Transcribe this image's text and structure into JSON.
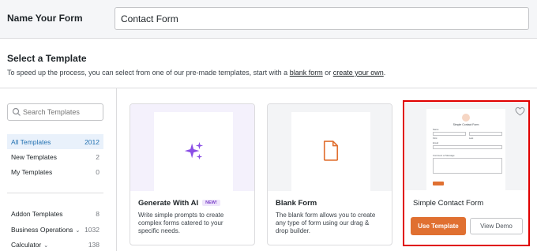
{
  "header": {
    "name_label": "Name Your Form",
    "name_value": "Contact Form"
  },
  "intro": {
    "title": "Select a Template",
    "desc_prefix": "To speed up the process, you can select from one of our pre-made templates, start with a ",
    "blank_link": "blank form",
    "desc_middle": " or ",
    "own_link": "create your own",
    "desc_suffix": "."
  },
  "sidebar": {
    "search_placeholder": "Search Templates",
    "items": [
      {
        "label": "All Templates",
        "count": "2012"
      },
      {
        "label": "New Templates",
        "count": "2"
      },
      {
        "label": "My Templates",
        "count": "0"
      },
      {
        "label": "Addon Templates",
        "count": "8"
      },
      {
        "label": "Business Operations",
        "count": "1032"
      },
      {
        "label": "Calculator",
        "count": "138"
      }
    ]
  },
  "cards": [
    {
      "title": "Generate With AI",
      "badge": "NEW!",
      "desc": "Write simple prompts to create complex forms catered to your specific needs."
    },
    {
      "title": "Blank Form",
      "desc": "The blank form allows you to create any type of form using our drag & drop builder."
    },
    {
      "title": "Simple Contact Form",
      "use_label": "Use Template",
      "demo_label": "View Demo"
    }
  ],
  "preview": {
    "title": "Simple Contact Form",
    "labels": [
      "Name",
      "First",
      "Last",
      "Email",
      "Comment or Message"
    ]
  },
  "colors": {
    "accent": "#e07031",
    "active": "#2271b1",
    "ai_purple": "#8b4fe6",
    "highlight": "#e00000"
  }
}
